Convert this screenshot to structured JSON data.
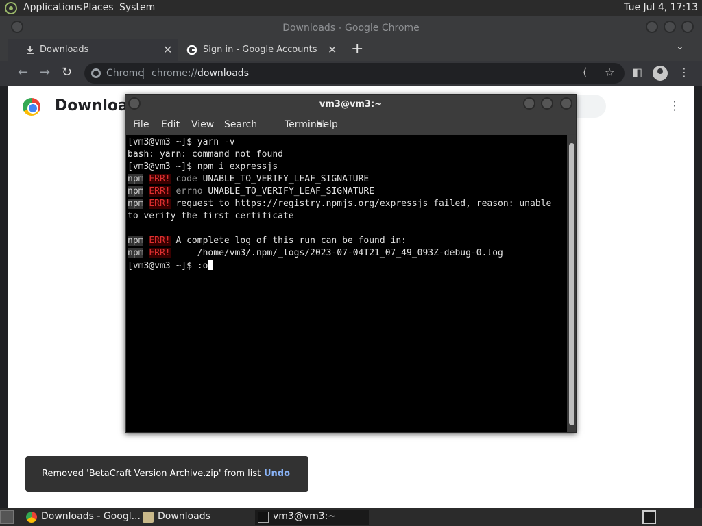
{
  "top_panel": {
    "applications": "Applications",
    "places": "Places",
    "system": "System",
    "clock": "Tue Jul  4, 17:13"
  },
  "chrome": {
    "window_title": "Downloads - Google Chrome",
    "tabs": [
      {
        "label": "Downloads",
        "icon": "download-icon"
      },
      {
        "label": "Sign in - Google Accounts",
        "icon": "google-g-icon"
      }
    ],
    "omnibox": {
      "origin": "Chrome",
      "url_prefix": "chrome://",
      "url_host": "downloads"
    },
    "page": {
      "heading": "Downloads"
    },
    "toast": {
      "message": "Removed 'BetaCraft Version Archive.zip' from list",
      "action": "Undo"
    }
  },
  "terminal": {
    "title": "vm3@vm3:~",
    "menu": [
      "File",
      "Edit",
      "Search",
      "Terminal",
      "Help"
    ],
    "menu_labels": {
      "file": "File",
      "edit": "Edit",
      "view": "View",
      "search": "Search",
      "terminal": "Terminal",
      "help": "Help"
    },
    "lines": {
      "l1": "[vm3@vm3 ~]$ yarn -v",
      "l2": "bash: yarn: command not found",
      "l3": "[vm3@vm3 ~]$ npm i expressjs",
      "npm": "npm",
      "err": "ERR!",
      "l4_key": "code",
      "l4_val": " UNABLE_TO_VERIFY_LEAF_SIGNATURE",
      "l5_key": "errno",
      "l5_val": " UNABLE_TO_VERIFY_LEAF_SIGNATURE",
      "l6": " request to https://registry.npmjs.org/expressjs failed, reason: unable",
      "l7": "to verify the first certificate",
      "l9": " A complete log of this run can be found in:",
      "l10": "     /home/vm3/.npm/_logs/2023-07-04T21_07_49_093Z-debug-0.log",
      "l11": "[vm3@vm3 ~]$ :o"
    }
  },
  "taskbar": {
    "items": [
      {
        "label": "Downloads - Googl...",
        "icon": "chrome-icon"
      },
      {
        "label": "Downloads",
        "icon": "folder-icon"
      },
      {
        "label": "vm3@vm3:~",
        "icon": "terminal-icon"
      }
    ]
  },
  "colors": {
    "panel": "#2b2b2b",
    "terminal_bg": "#000000",
    "error_red": "#e03030",
    "link_blue": "#8ab4f8"
  }
}
